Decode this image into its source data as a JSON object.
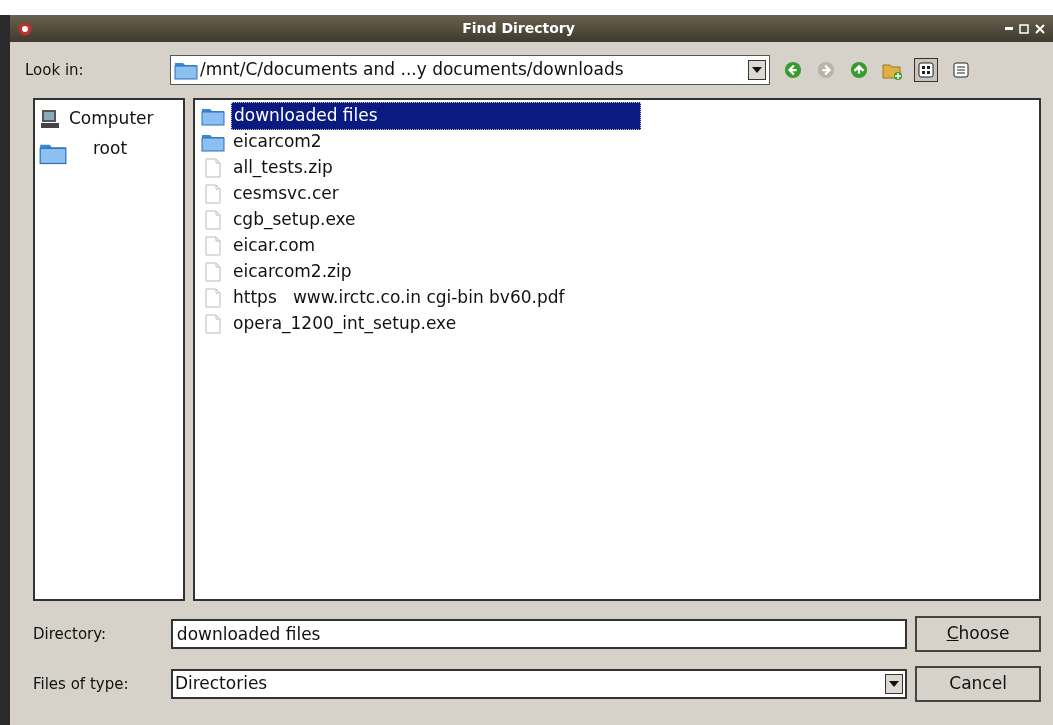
{
  "window": {
    "title": "Find Directory"
  },
  "look_in": {
    "label": "Look in:",
    "value": "/mnt/C/documents and ...y documents/downloads"
  },
  "view_buttons": [
    {
      "kind": "icons",
      "selected": true
    },
    {
      "kind": "list",
      "selected": false
    }
  ],
  "places": [
    {
      "kind": "computer",
      "label": "Computer"
    },
    {
      "kind": "folder",
      "label": "root"
    }
  ],
  "files": [
    {
      "kind": "folder",
      "name": "downloaded files",
      "selected": true
    },
    {
      "kind": "folder",
      "name": "eicarcom2",
      "selected": false
    },
    {
      "kind": "file",
      "name": "all_tests.zip",
      "selected": false
    },
    {
      "kind": "file",
      "name": "cesmsvc.cer",
      "selected": false
    },
    {
      "kind": "file",
      "name": "cgb_setup.exe",
      "selected": false
    },
    {
      "kind": "file",
      "name": "eicar.com",
      "selected": false
    },
    {
      "kind": "file",
      "name": "eicarcom2.zip",
      "selected": false
    },
    {
      "kind": "file",
      "name": "https   www.irctc.co.in cgi-bin bv60.pdf",
      "selected": false
    },
    {
      "kind": "file",
      "name": "opera_1200_int_setup.exe",
      "selected": false
    }
  ],
  "directory": {
    "label": "Directory:",
    "value": "downloaded files"
  },
  "files_of_type": {
    "label": "Files of type:",
    "value": "Directories"
  },
  "buttons": [
    {
      "label": "Choose",
      "mnemonic": true
    },
    {
      "label": "Cancel",
      "mnemonic": false
    }
  ]
}
